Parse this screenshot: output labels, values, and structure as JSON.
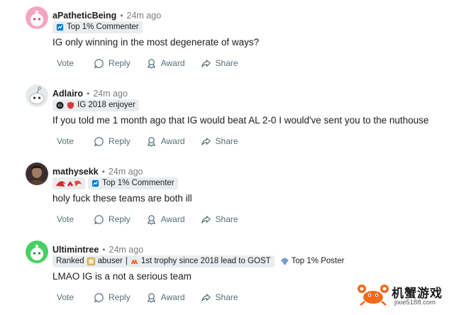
{
  "colors": {
    "action_gray": "#576f76",
    "flair_bg": "#eaedef",
    "meta_gray": "#7c7c7c"
  },
  "comments": [
    {
      "username": "aPatheticBeing",
      "time": "24m ago",
      "avatar": "pink-snoo-avatar",
      "flairs": [
        {
          "icon": "achievement-icon",
          "text": "Top 1% Commenter"
        }
      ],
      "text": "IG only winning in the most degenerate of ways?",
      "actions": {
        "vote": "Vote",
        "reply": "Reply",
        "award": "Award",
        "share": "Share"
      }
    },
    {
      "username": "Adlairo",
      "time": "24m ago",
      "avatar": "gray-snoo-avatar",
      "flairs": [
        {
          "icon": "ig-team-icon",
          "text": "IG 2018 enjoyer"
        }
      ],
      "text": "If you told me 1 month ago that IG would beat AL 2-0 I would've sent you to the nuthouse",
      "actions": {
        "vote": "Vote",
        "reply": "Reply",
        "award": "Award",
        "share": "Share"
      }
    },
    {
      "username": "mathysekk",
      "time": "24m ago",
      "avatar": "photo-avatar",
      "flairs": [
        {
          "icon": "team-logos-icon",
          "text": ""
        },
        {
          "icon": "achievement-icon",
          "text": "Top 1% Commenter"
        }
      ],
      "text": "holy fuck these teams are both ill",
      "actions": {
        "vote": "Vote",
        "reply": "Reply",
        "award": "Award",
        "share": "Share"
      }
    },
    {
      "username": "Ultimintree",
      "time": "24m ago",
      "avatar": "green-snoo-avatar",
      "flairs": [
        {
          "icon": "",
          "text": "Ranked"
        },
        {
          "icon": "abuser-icon",
          "text": "abuser"
        },
        {
          "icon": "fnc-icon",
          "text": "1st trophy since 2018 lead to GOST"
        },
        {
          "icon": "achievement-icon",
          "text": "Top 1% Poster"
        }
      ],
      "text": "LMAO IG is a not a serious team",
      "actions": {
        "vote": "Vote",
        "reply": "Reply",
        "award": "Award",
        "share": "Share"
      }
    }
  ],
  "watermark": {
    "title": "机蟹游戏",
    "url": "jixie5188.com"
  }
}
